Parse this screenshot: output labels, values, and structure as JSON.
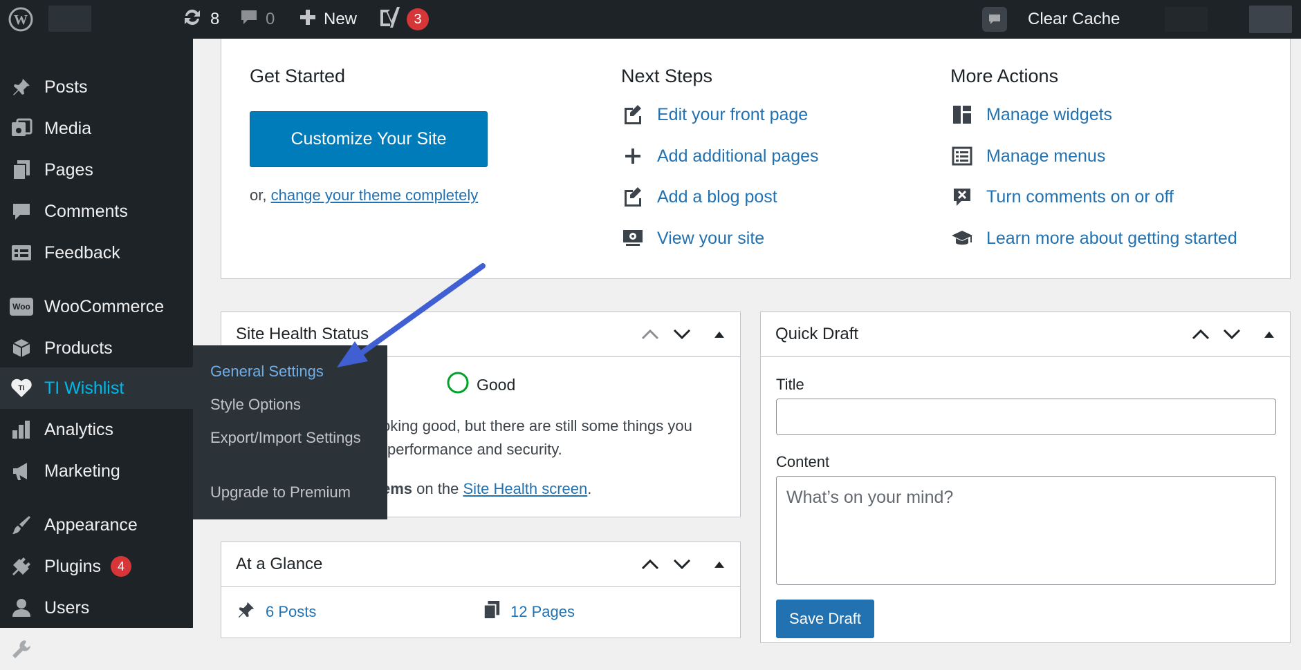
{
  "admin_bar": {
    "updates_count": "8",
    "comments_count": "0",
    "new_label": "New",
    "yoast_badge": "3",
    "clear_cache_label": "Clear Cache"
  },
  "sidebar": {
    "items": [
      {
        "label": "Posts",
        "icon": "pin-icon"
      },
      {
        "label": "Media",
        "icon": "media-icon"
      },
      {
        "label": "Pages",
        "icon": "pages-icon"
      },
      {
        "label": "Comments",
        "icon": "comment-icon"
      },
      {
        "label": "Feedback",
        "icon": "feedback-icon"
      },
      {
        "label": "WooCommerce",
        "icon": "woo-icon"
      },
      {
        "label": "Products",
        "icon": "box-icon"
      },
      {
        "label": "TI Wishlist",
        "icon": "heart-icon"
      },
      {
        "label": "Analytics",
        "icon": "bar-chart-icon"
      },
      {
        "label": "Marketing",
        "icon": "megaphone-icon"
      },
      {
        "label": "Appearance",
        "icon": "paintbrush-icon"
      },
      {
        "label": "Plugins",
        "icon": "plug-icon",
        "badge": "4"
      },
      {
        "label": "Users",
        "icon": "user-icon"
      },
      {
        "label": "Tools",
        "icon": "wrench-icon"
      }
    ],
    "woo_icon_text": "Woo"
  },
  "flyout": {
    "items": [
      "General Settings",
      "Style Options",
      "Export/Import Settings",
      "Upgrade to Premium"
    ]
  },
  "welcome": {
    "get_started": "Get Started",
    "customize_button": "Customize Your Site",
    "or_text": "or,",
    "change_theme_link": "change your theme completely",
    "next_steps": "Next Steps",
    "next_steps_items": [
      "Edit your front page",
      "Add additional pages",
      "Add a blog post",
      "View your site"
    ],
    "more_actions": "More Actions",
    "more_actions_items": [
      "Manage widgets",
      "Manage menus",
      "Turn comments on or off",
      "Learn more about getting started"
    ]
  },
  "site_health": {
    "title": "Site Health Status",
    "status": "Good",
    "text_line1": "oking good, but there are still some things you",
    "text_line2": "performance and security.",
    "items_fragment": "ems",
    "on_the": "on the",
    "screen_link": "Site Health screen",
    "period": "."
  },
  "at_a_glance": {
    "title": "At a Glance",
    "posts": "6 Posts",
    "pages": "12 Pages"
  },
  "quick_draft": {
    "title": "Quick Draft",
    "title_label": "Title",
    "content_label": "Content",
    "content_placeholder": "What’s on your mind?",
    "save_button": "Save Draft"
  },
  "colors": {
    "accent": "#2271b1",
    "admin_bg": "#1d2327",
    "arrow": "#3f5fd3"
  }
}
